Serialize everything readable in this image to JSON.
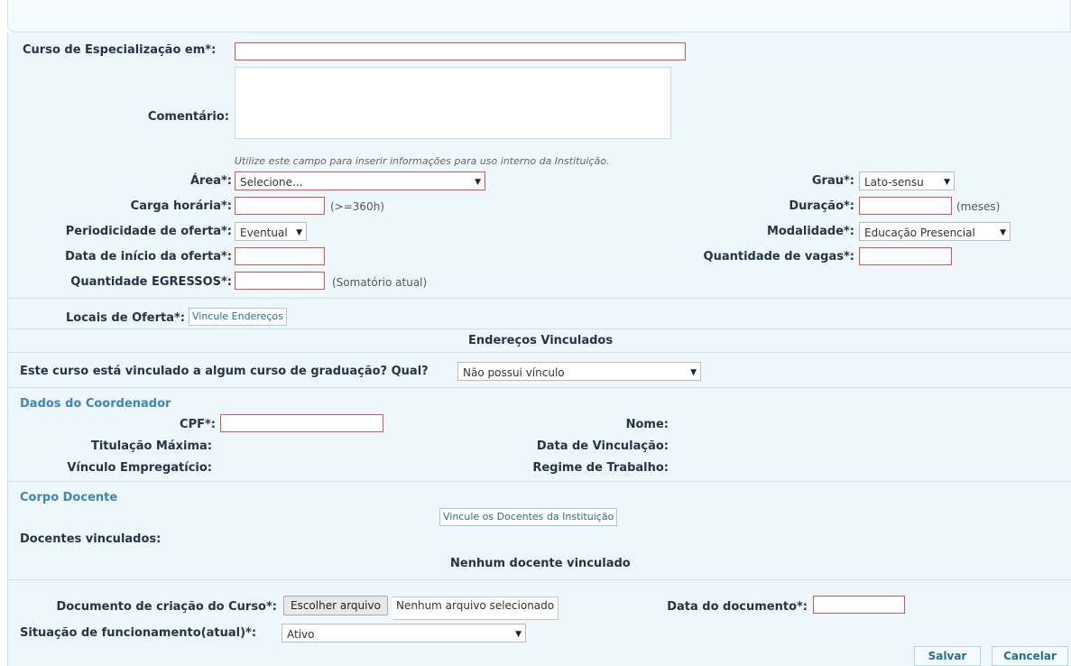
{
  "form": {
    "curso_label": "Curso de Especialização em*:",
    "curso_value": "",
    "comentario_label": "Comentário:",
    "comentario_value": "",
    "comentario_hint": "Utilize este campo para inserir informações para uso interno da Instituição.",
    "area_label": "Área*:",
    "area_value": "Selecione...",
    "grau_label": "Grau*:",
    "grau_value": "Lato-sensu",
    "carga_label": "Carga horária*:",
    "carga_hint": "(>=360h)",
    "duracao_label": "Duração*:",
    "duracao_hint": "(meses)",
    "periodicidade_label": "Periodicidade de oferta*:",
    "periodicidade_value": "Eventual",
    "modalidade_label": "Modalidade*:",
    "modalidade_value": "Educação Presencial",
    "data_inicio_label": "Data de início da oferta*:",
    "qtd_vagas_label": "Quantidade de vagas*:",
    "qtd_egressos_label": "Quantidade EGRESSOS*:",
    "qtd_egressos_hint": "(Somatório atual)",
    "locais_label": "Locais de Oferta*:",
    "vincule_enderecos": "Vincule Endereços",
    "enderecos_vinculados": "Endereços Vinculados",
    "vinculo_graduacao_label": "Este curso está vinculado a algum curso de graduação? Qual?",
    "vinculo_graduacao_value": "Não possui vínculo"
  },
  "coordenador": {
    "title": "Dados do Coordenador",
    "cpf_label": "CPF*:",
    "nome_label": "Nome:",
    "titulacao_label": "Titulação Máxima:",
    "data_vinculacao_label": "Data de Vinculação:",
    "vinculo_label": "Vínculo Empregatício:",
    "regime_label": "Regime de Trabalho:"
  },
  "docentes": {
    "title": "Corpo Docente",
    "vincule_button": "Vincule os Docentes da Instituição",
    "vinculados_label": "Docentes vinculados:",
    "empty_message": "Nenhum docente vinculado"
  },
  "documento": {
    "label": "Documento de criação do Curso*:",
    "file_button": "Escolher arquivo",
    "file_status": "Nenhum arquivo selecionado",
    "data_label": "Data do documento*:",
    "situacao_label": "Situação de funcionamento(atual)*:",
    "situacao_value": "Ativo"
  },
  "actions": {
    "salvar": "Salvar",
    "cancelar": "Cancelar"
  }
}
